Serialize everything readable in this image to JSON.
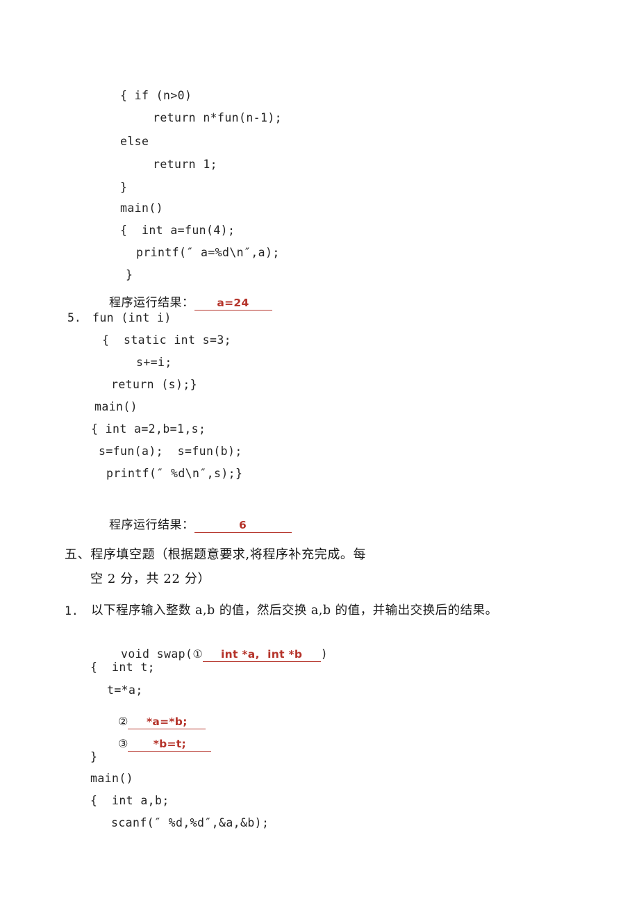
{
  "document": {
    "kind": "exam-answer-sheet",
    "language": "zh-CN"
  },
  "question4": {
    "code_lines": [
      "{ if (n>0)",
      "return n*fun(n-1);",
      "else",
      "return 1;",
      "}",
      "main()",
      "{  int a=fun(4);",
      "printf(″ a=%d\\n″,a);",
      "}"
    ],
    "result_label": "程序运行结果：",
    "result_answer": "a=24"
  },
  "question5": {
    "number": "5.",
    "signature": "fun (int i)",
    "code_lines": [
      "{  static int s=3;",
      "s+=i;",
      "return (s);}",
      "main()",
      "{ int a=2,b=1,s;",
      "s=fun(a);  s=fun(b);",
      "printf(″ %d\\n″,s);}"
    ],
    "result_label": "程序运行结果：",
    "result_answer": "6"
  },
  "section5": {
    "heading_line1": "五、程序填空题（根据题意要求,将程序补充完成。每",
    "heading_line2": "空 2 分，共 22 分）"
  },
  "fill1": {
    "number": "1.",
    "prompt": "以下程序输入整数 a,b 的值，然后交换 a,b 的值，并输出交换后的结果。",
    "swap_prefix": "void swap(",
    "blank1_marker": "①",
    "blank1_answer": "int *a,  int *b",
    "swap_suffix": ")",
    "body_line1": "{  int t;",
    "body_line2": "t=*a;",
    "blank2_marker": "②",
    "blank2_answer": "*a=*b;",
    "blank3_marker": "③",
    "blank3_answer": "*b=t;",
    "body_close": "}",
    "main_lines": [
      "main()",
      "{  int a,b;",
      "scanf(″ %d,%d″,&a,&b);"
    ]
  },
  "colors": {
    "answer_red": "#b5332a",
    "body_text": "#252525",
    "page_background": "#ffffff"
  }
}
